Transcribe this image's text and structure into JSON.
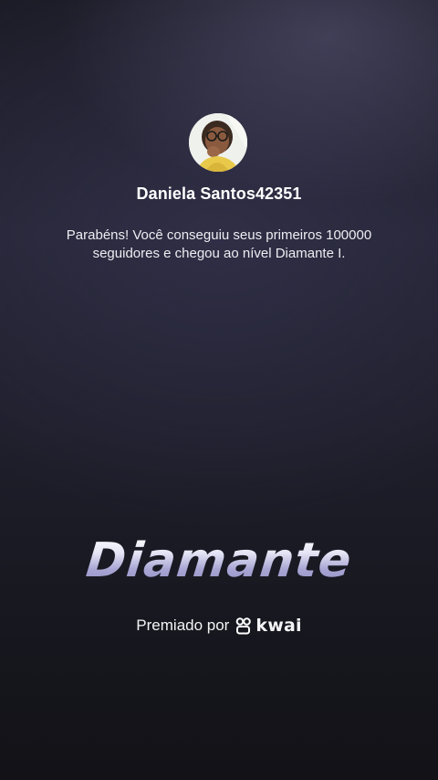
{
  "profile": {
    "username": "Daniela Santos42351",
    "avatar_icon": "user-photo-avatar"
  },
  "message": {
    "line1": "Parabéns! Você conseguiu seus primeiros 100000",
    "line2": "seguidores e chegou ao nível Diamante I."
  },
  "level": {
    "title": "Diamante"
  },
  "award": {
    "prefix": "Premiado por",
    "brand": "kwai",
    "brand_icon": "kwai-logo-icon"
  }
}
